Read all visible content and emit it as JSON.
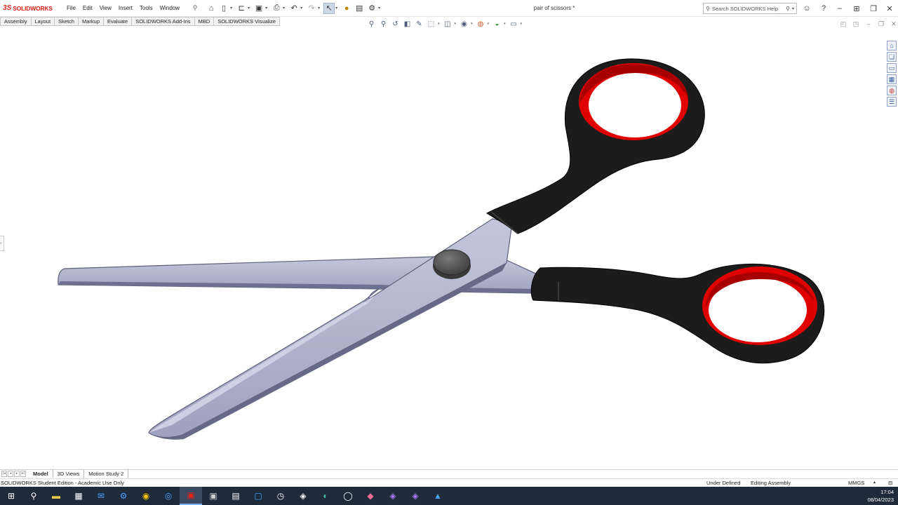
{
  "app": {
    "logo_ds": "3S",
    "logo_name": "SOLIDWORKS",
    "document_title": "pair of scissors *",
    "search_placeholder": "Search SOLIDWORKS Help"
  },
  "menu": [
    "File",
    "Edit",
    "View",
    "Insert",
    "Tools",
    "Window"
  ],
  "command_tabs": [
    "Assembly",
    "Layout",
    "Sketch",
    "Markup",
    "Evaluate",
    "SOLIDWORKS Add-Ins",
    "MBD",
    "SOLIDWORKS Visualize"
  ],
  "bottom_tabs": [
    "Model",
    "3D Views",
    "Motion Study 2"
  ],
  "status": {
    "edition": "SOLIDWORKS Student Edition - Academic Use Only",
    "definition": "Under Defined",
    "mode": "Editing Assembly",
    "units": "MMGS"
  },
  "clock": {
    "time": "17:04",
    "date": "08/04/2023"
  },
  "colors": {
    "handle": "#1c1c1c",
    "handle_inner": "#e00000",
    "blade": "#a9adc8",
    "blade_edge": "#5d6079",
    "pivot": "#555555",
    "logo": "#e2231a",
    "taskbar": "#1f2a3a"
  },
  "icons": {
    "quick_access": [
      "home-icon",
      "new-document-icon",
      "open-icon",
      "save-icon",
      "print-icon",
      "undo-icon",
      "redo-icon",
      "select-icon",
      "traffic-light-icon",
      "file-properties-icon",
      "options-icon"
    ],
    "heads_up": [
      "zoom-to-fit-icon",
      "zoom-area-icon",
      "previous-view-icon",
      "section-view-icon",
      "dynamic-annotation-icon",
      "view-orientation-icon",
      "display-style-icon",
      "hide-show-icon",
      "appearance-icon",
      "scene-icon",
      "display-settings-icon"
    ],
    "task_pane": [
      "resources-icon",
      "design-library-icon",
      "file-explorer-icon",
      "view-palette-icon",
      "appearances-icon",
      "custom-properties-icon"
    ],
    "taskbar": [
      "windows-start-icon",
      "search-icon",
      "file-explorer-icon",
      "calendar-icon",
      "mail-icon",
      "app-icon",
      "chrome-icon",
      "safari-icon",
      "solidworks-icon",
      "solidworks-2022-icon",
      "calculator-icon",
      "store-icon",
      "clock-icon",
      "app-icon-2",
      "edge-icon",
      "app-icon-3",
      "app-icon-4",
      "vs-icon",
      "vs-icon-2",
      "photos-icon"
    ]
  }
}
